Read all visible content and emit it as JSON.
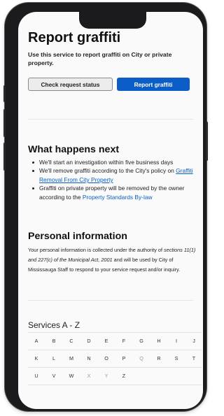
{
  "page": {
    "title": "Report graffiti",
    "intro": "Use this service to report graffiti on City or private property."
  },
  "buttons": {
    "check_status": "Check request status",
    "report": "Report graffiti"
  },
  "what_next": {
    "heading": "What happens next",
    "item1": "We'll start an investigation within five business days",
    "item2_prefix": "We'll remove graffiti according to the City's policy on ",
    "item2_link": "Graffiti Removal From City Property",
    "item3_prefix": "Graffiti on private property will be removed by the owner according to the ",
    "item3_link": "Property Standards By-law"
  },
  "personal": {
    "heading": "Personal information",
    "text_a": "Your personal information is collected under the authority of ",
    "text_italic": "sections 11(1) and 227(c) of the Municipal Act, 2001",
    "text_b": " and will be used by City of Mississauga Staff to respond to your service request and/or inquiry."
  },
  "services": {
    "heading": "Services A - Z",
    "rows": [
      [
        "A",
        "B",
        "C",
        "D",
        "E",
        "F",
        "G",
        "H",
        "I",
        "J"
      ],
      [
        "K",
        "L",
        "M",
        "N",
        "O",
        "P",
        "Q",
        "R",
        "S",
        "T"
      ],
      [
        "U",
        "V",
        "W",
        "X",
        "Y",
        "Z"
      ]
    ],
    "disabled_letters": [
      "Q",
      "X",
      "Y"
    ]
  },
  "colors": {
    "primary": "#0b5ec8",
    "link": "#0b5ec8",
    "device": "#1b1b1d"
  }
}
